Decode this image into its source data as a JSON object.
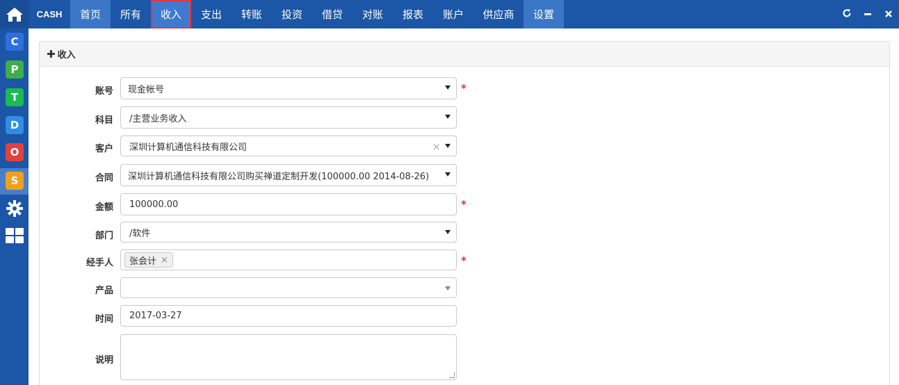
{
  "brand": "CASH",
  "nav": {
    "tabs": [
      {
        "label": "首页",
        "name": "tab-home",
        "cls": "home-tab",
        "w": 58
      },
      {
        "label": "所有",
        "name": "tab-all",
        "cls": "",
        "w": 58
      },
      {
        "label": "收入",
        "name": "tab-income",
        "cls": "sel",
        "w": 58
      },
      {
        "label": "支出",
        "name": "tab-expense",
        "cls": "",
        "w": 58
      },
      {
        "label": "转账",
        "name": "tab-transfer",
        "cls": "",
        "w": 58
      },
      {
        "label": "投资",
        "name": "tab-invest",
        "cls": "",
        "w": 58
      },
      {
        "label": "借贷",
        "name": "tab-loan",
        "cls": "",
        "w": 58
      },
      {
        "label": "对账",
        "name": "tab-reconcile",
        "cls": "",
        "w": 58
      },
      {
        "label": "报表",
        "name": "tab-report",
        "cls": "",
        "w": 58
      },
      {
        "label": "账户",
        "name": "tab-account",
        "cls": "",
        "w": 58
      },
      {
        "label": "供应商",
        "name": "tab-supplier",
        "cls": "",
        "w": 72
      },
      {
        "label": "设置",
        "name": "tab-settings",
        "cls": "settings",
        "w": 58
      }
    ]
  },
  "window_controls": {
    "refresh": "C",
    "minimize": "−",
    "close": "×"
  },
  "rail": [
    {
      "letter": "C",
      "color": "#2f6fe0",
      "name": "app-c-icon"
    },
    {
      "letter": "P",
      "color": "#3fae49",
      "name": "app-p-icon"
    },
    {
      "letter": "T",
      "color": "#1db954",
      "name": "app-t-icon"
    },
    {
      "letter": "D",
      "color": "#2f8de4",
      "name": "app-d-icon"
    },
    {
      "letter": "O",
      "color": "#e2423e",
      "name": "app-o-icon"
    },
    {
      "letter": "S",
      "color": "#f0a020",
      "name": "app-s-icon"
    }
  ],
  "panel": {
    "title": "收入"
  },
  "form": {
    "account": {
      "label": "账号",
      "value": "现金帐号"
    },
    "subject": {
      "label": "科目",
      "value": "/主营业务收入"
    },
    "customer": {
      "label": "客户",
      "value": "深圳计算机通信科技有限公司"
    },
    "contract": {
      "label": "合同",
      "value": "深圳计算机通信科技有限公司购买禅道定制开发(100000.00 2014-08-26)"
    },
    "amount": {
      "label": "金额",
      "value": "100000.00"
    },
    "department": {
      "label": "部门",
      "value": "/软件"
    },
    "handler": {
      "label": "经手人",
      "chip": "张会计"
    },
    "product": {
      "label": "产品",
      "value": ""
    },
    "date": {
      "label": "时间",
      "value": "2017-03-27"
    },
    "desc": {
      "label": "说明",
      "value": ""
    }
  },
  "required_mark": "*"
}
